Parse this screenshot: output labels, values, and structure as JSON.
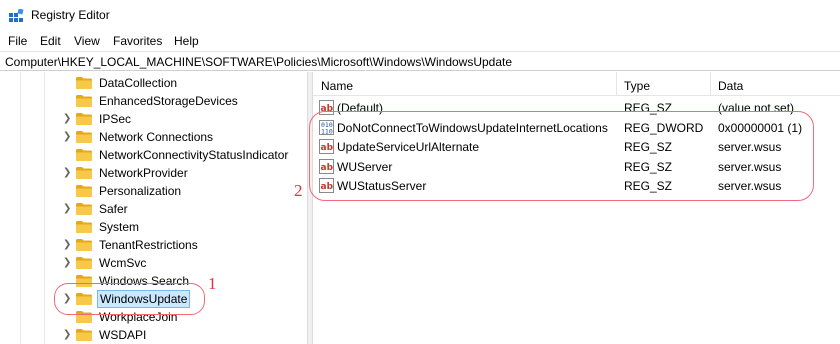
{
  "window": {
    "title": "Registry Editor",
    "icon": "registry-editor-icon"
  },
  "menu": [
    "File",
    "Edit",
    "View",
    "Favorites",
    "Help"
  ],
  "address": "Computer\\HKEY_LOCAL_MACHINE\\SOFTWARE\\Policies\\Microsoft\\Windows\\WindowsUpdate",
  "tree": {
    "items": [
      {
        "label": "DataCollection",
        "expandable": false
      },
      {
        "label": "EnhancedStorageDevices",
        "expandable": false
      },
      {
        "label": "IPSec",
        "expandable": true
      },
      {
        "label": "Network Connections",
        "expandable": true
      },
      {
        "label": "NetworkConnectivityStatusIndicator",
        "expandable": false
      },
      {
        "label": "NetworkProvider",
        "expandable": true
      },
      {
        "label": "Personalization",
        "expandable": false
      },
      {
        "label": "Safer",
        "expandable": true
      },
      {
        "label": "System",
        "expandable": false
      },
      {
        "label": "TenantRestrictions",
        "expandable": true
      },
      {
        "label": "WcmSvc",
        "expandable": true
      },
      {
        "label": "Windows Search",
        "expandable": false
      },
      {
        "label": "WindowsUpdate",
        "expandable": true,
        "selected": true
      },
      {
        "label": "WorkplaceJoin",
        "expandable": false
      },
      {
        "label": "WSDAPI",
        "expandable": true
      }
    ]
  },
  "list": {
    "columns": {
      "name": "Name",
      "type": "Type",
      "data": "Data"
    },
    "rows": [
      {
        "name": "(Default)",
        "type": "REG_SZ",
        "data": "(value not set)",
        "icon": "string-value-icon"
      },
      {
        "name": "DoNotConnectToWindowsUpdateInternetLocations",
        "type": "REG_DWORD",
        "data": "0x00000001 (1)",
        "icon": "dword-value-icon"
      },
      {
        "name": "UpdateServiceUrlAlternate",
        "type": "REG_SZ",
        "data": "server.wsus",
        "icon": "string-value-icon"
      },
      {
        "name": "WUServer",
        "type": "REG_SZ",
        "data": "server.wsus",
        "icon": "string-value-icon"
      },
      {
        "name": "WUStatusServer",
        "type": "REG_SZ",
        "data": "server.wsus",
        "icon": "string-value-icon"
      }
    ]
  },
  "annotations": {
    "one": "1",
    "two": "2",
    "color": "#e0303e"
  },
  "colors": {
    "selection": "#cce8ff",
    "folder": "#f5c543"
  }
}
